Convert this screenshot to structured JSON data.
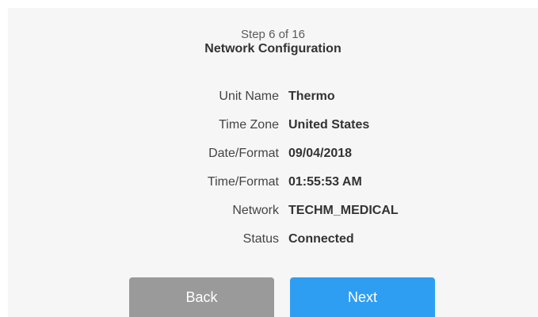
{
  "header": {
    "step": "Step 6 of 16",
    "title": "Network Configuration"
  },
  "info": [
    {
      "label": "Unit Name",
      "value": "Thermo"
    },
    {
      "label": "Time Zone",
      "value": "United States"
    },
    {
      "label": "Date/Format",
      "value": "09/04/2018"
    },
    {
      "label": "Time/Format",
      "value": "01:55:53 AM"
    },
    {
      "label": "Network",
      "value": "TECHM_MEDICAL"
    },
    {
      "label": "Status",
      "value": "Connected"
    }
  ],
  "buttons": {
    "back_label": "Back",
    "next_label": "Next"
  },
  "colors": {
    "background": "#f6f6f6",
    "back_button": "#9a9a9a",
    "next_button": "#2e9ef2"
  }
}
